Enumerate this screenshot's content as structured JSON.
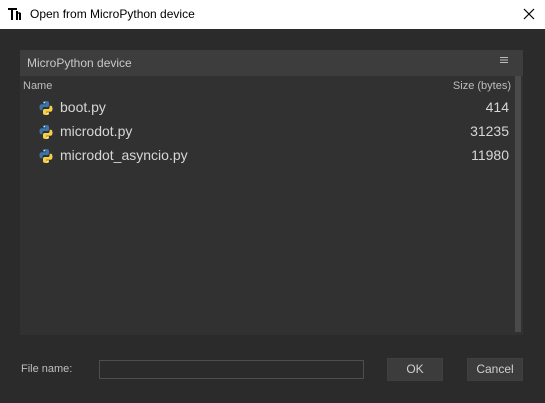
{
  "window": {
    "title": "Open from MicroPython device",
    "logo_icon": "thonny-logo-icon",
    "close_icon": "close-icon"
  },
  "browser": {
    "header_title": "MicroPython device",
    "menu_icon": "hamburger-menu-icon",
    "columns": {
      "name": "Name",
      "size": "Size (bytes)"
    },
    "files": [
      {
        "name": "boot.py",
        "size": "414",
        "icon": "python-file-icon"
      },
      {
        "name": "microdot.py",
        "size": "31235",
        "icon": "python-file-icon"
      },
      {
        "name": "microdot_asyncio.py",
        "size": "11980",
        "icon": "python-file-icon"
      }
    ]
  },
  "footer": {
    "file_name_label": "File name:",
    "file_name_value": "",
    "ok_label": "OK",
    "cancel_label": "Cancel"
  },
  "colors": {
    "background": "#2b2b2b",
    "panel": "#313131",
    "panel_header": "#3d3d3d",
    "python_blue": "#3b75a8",
    "python_yellow": "#f7d047"
  }
}
